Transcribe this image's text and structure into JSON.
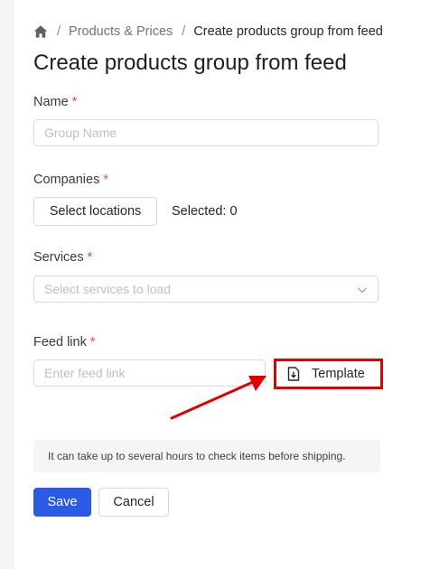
{
  "breadcrumb": {
    "home_icon": "home-icon",
    "separator": "/",
    "items": [
      {
        "label": "Products & Prices"
      },
      {
        "label": "Create products group from feed"
      }
    ]
  },
  "page": {
    "title": "Create products group from feed"
  },
  "form": {
    "name": {
      "label": "Name",
      "required_mark": "*",
      "placeholder": "Group Name"
    },
    "companies": {
      "label": "Companies",
      "required_mark": "*",
      "select_button_label": "Select locations",
      "selected_text": "Selected: 0"
    },
    "services": {
      "label": "Services",
      "required_mark": "*",
      "placeholder": "Select services to load",
      "icon": "chevron-down-icon"
    },
    "feed_link": {
      "label": "Feed link",
      "required_mark": "*",
      "placeholder": "Enter feed link",
      "template_button_label": "Template",
      "template_icon": "file-download-icon"
    },
    "notice": "It can take up to several hours to check items before shipping."
  },
  "actions": {
    "save_label": "Save",
    "cancel_label": "Cancel"
  },
  "annotation": {
    "highlight_color": "#e00000",
    "arrow_color": "#e00000"
  },
  "colors": {
    "primary": "#2b5be3",
    "required": "#e5484d"
  }
}
